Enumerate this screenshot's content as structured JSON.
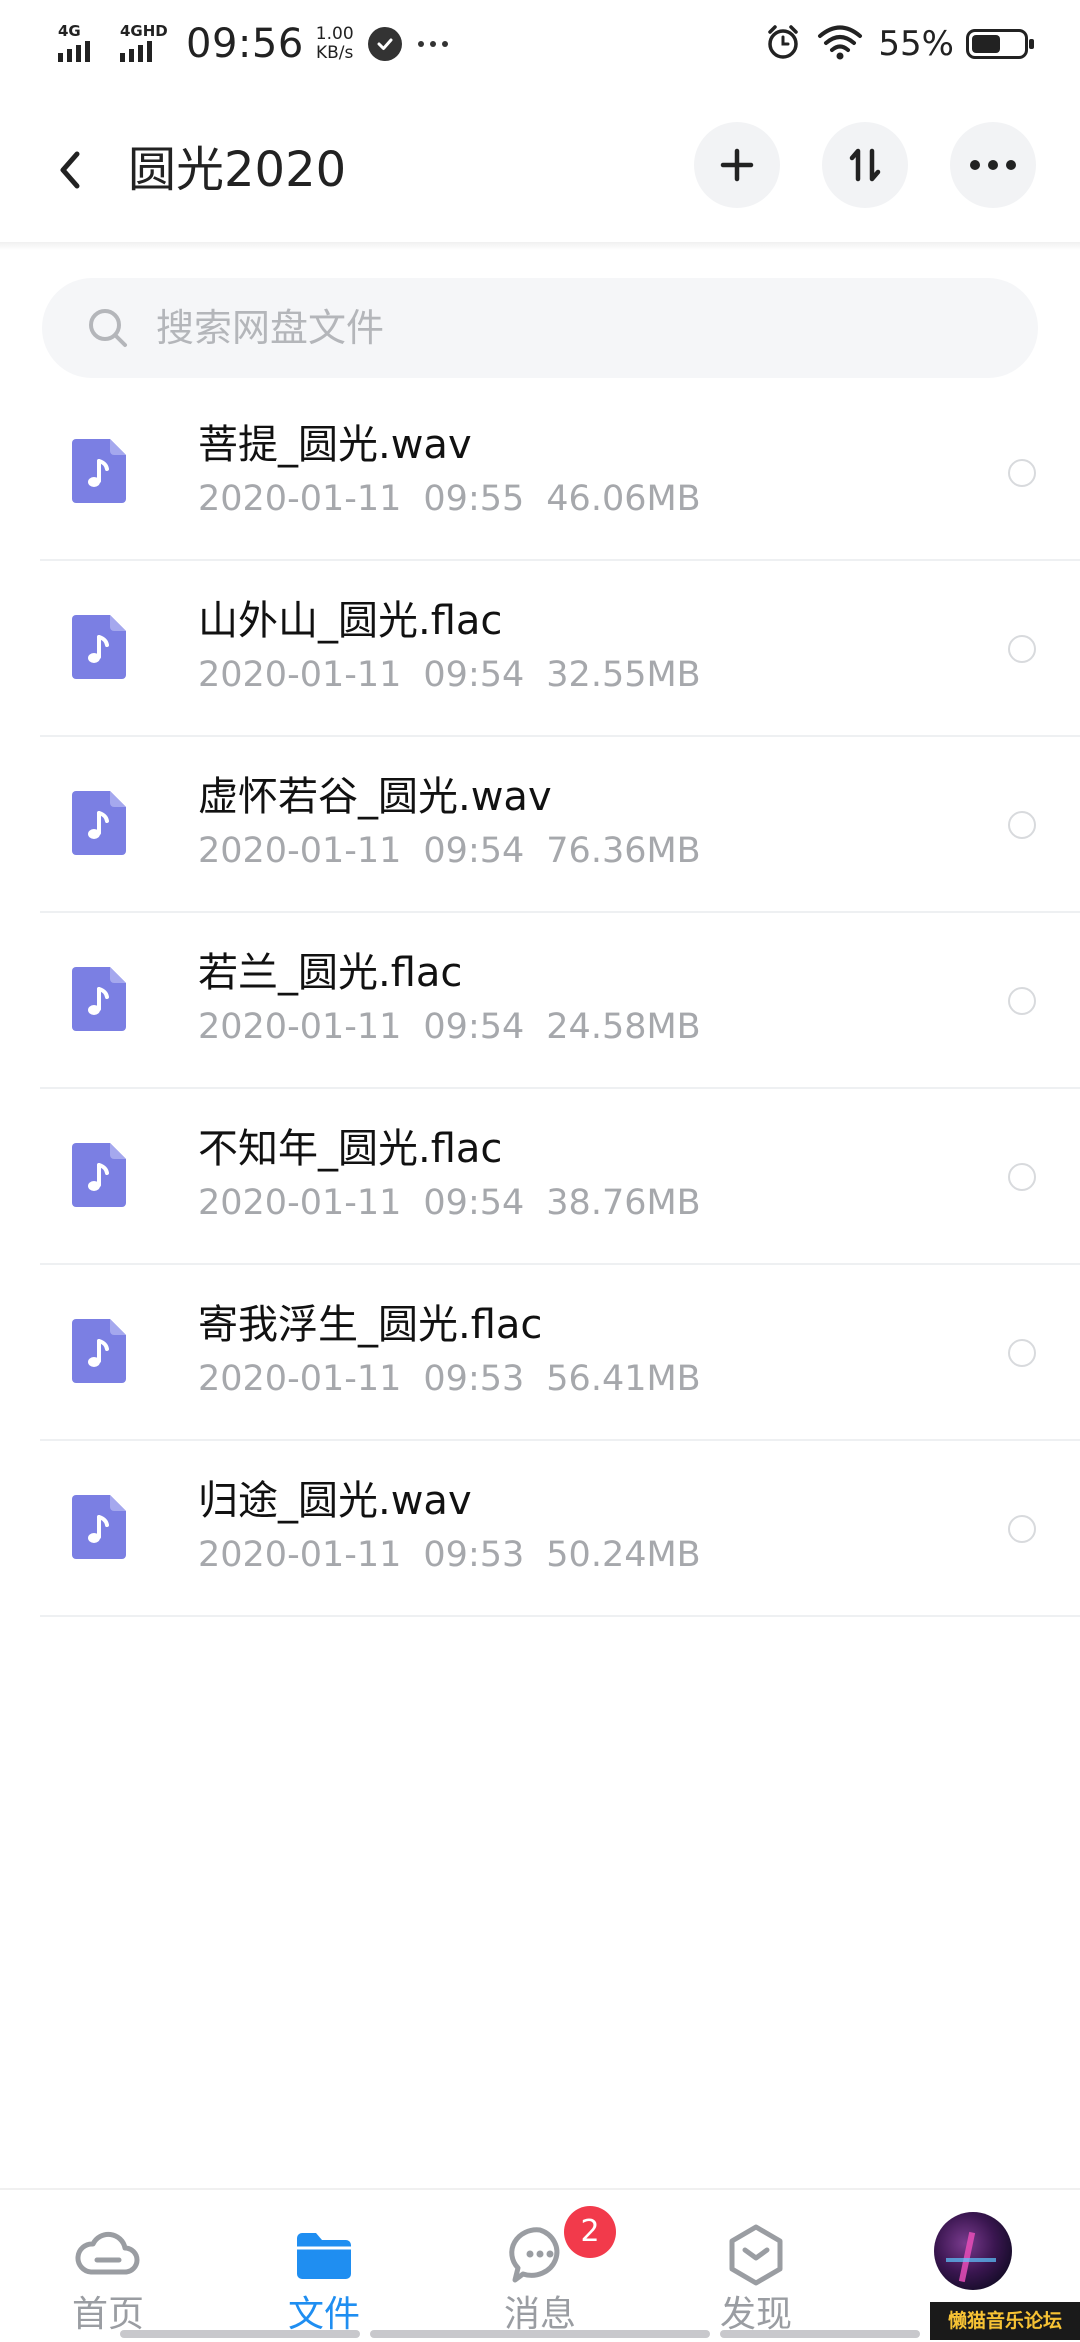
{
  "status_bar": {
    "signal1_label": "4G",
    "signal2_label": "4GHD",
    "time": "09:56",
    "speed_value": "1.00",
    "speed_unit": "KB/s",
    "battery_percent": "55%",
    "battery_level": 0.55
  },
  "header": {
    "title": "圆光2020",
    "back_icon": "chevron-left-icon",
    "actions": [
      "add-icon",
      "sort-icon",
      "more-icon"
    ]
  },
  "search": {
    "placeholder": "搜索网盘文件"
  },
  "files": [
    {
      "name": "菩提_圆光.wav",
      "date": "2020-01-11",
      "time": "09:55",
      "size": "46.06MB"
    },
    {
      "name": "山外山_圆光.flac",
      "date": "2020-01-11",
      "time": "09:54",
      "size": "32.55MB"
    },
    {
      "name": "虚怀若谷_圆光.wav",
      "date": "2020-01-11",
      "time": "09:54",
      "size": "76.36MB"
    },
    {
      "name": "若兰_圆光.flac",
      "date": "2020-01-11",
      "time": "09:54",
      "size": "24.58MB"
    },
    {
      "name": "不知年_圆光.flac",
      "date": "2020-01-11",
      "time": "09:54",
      "size": "38.76MB"
    },
    {
      "name": "寄我浮生_圆光.flac",
      "date": "2020-01-11",
      "time": "09:53",
      "size": "56.41MB"
    },
    {
      "name": "归途_圆光.wav",
      "date": "2020-01-11",
      "time": "09:53",
      "size": "50.24MB"
    }
  ],
  "bottom_nav": {
    "items": [
      {
        "label": "首页",
        "icon": "cloud-icon",
        "active": false
      },
      {
        "label": "文件",
        "icon": "folder-icon",
        "active": true
      },
      {
        "label": "消息",
        "icon": "chat-icon",
        "active": false,
        "badge": "2"
      },
      {
        "label": "发现",
        "icon": "discover-icon",
        "active": false
      }
    ]
  },
  "watermark": "懒猫音乐论坛",
  "colors": {
    "accent": "#1f8ef1",
    "file_icon": "#7b7fe3",
    "badge": "#f23a4b",
    "meta_text": "#a6a8ac"
  }
}
